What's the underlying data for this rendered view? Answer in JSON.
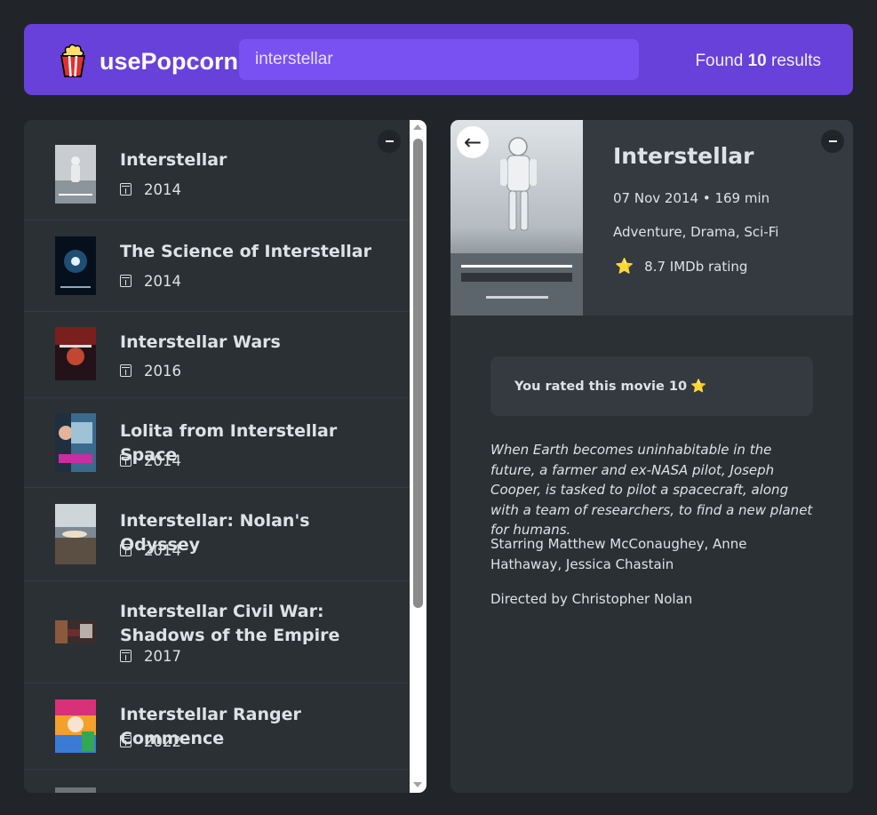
{
  "nav": {
    "logo_text": "usePopcorn",
    "search_value": "interstellar",
    "results_prefix": "Found ",
    "results_count": "10",
    "results_suffix": " results"
  },
  "movies": [
    {
      "title": "Interstellar",
      "year": "2014"
    },
    {
      "title": "The Science of Interstellar",
      "year": "2014"
    },
    {
      "title": "Interstellar Wars",
      "year": "2016"
    },
    {
      "title": "Lolita from Interstellar Space",
      "year": "2014"
    },
    {
      "title": "Interstellar: Nolan's Odyssey",
      "year": "2014"
    },
    {
      "title": "Interstellar Civil War: Shadows of the Empire",
      "year": "2017"
    },
    {
      "title": "Interstellar Ranger Commence",
      "year": "2022–"
    }
  ],
  "details": {
    "back_icon": "←",
    "title": "Interstellar",
    "meta": "07 Nov 2014 • 169 min",
    "genre": "Adventure, Drama, Sci-Fi",
    "rating_star": "⭐",
    "rating": "8.7 IMDb rating",
    "user_rated": "You rated this movie 10",
    "user_rated_star": "⭐",
    "plot": "When Earth becomes uninhabitable in the future, a farmer and ex-NASA pilot, Joseph Cooper, is tasked to pilot a spacecraft, along with a team of researchers, to find a new planet for humans.",
    "starring": "Starring Matthew McConaughey, Anne Hathaway, Jessica Chastain",
    "director": "Directed by Christopher Nolan"
  },
  "colors": {
    "background": "#212529",
    "nav": "#6741d9",
    "search": "#7950f2",
    "box": "#2b3035",
    "star": "#fcc419"
  }
}
